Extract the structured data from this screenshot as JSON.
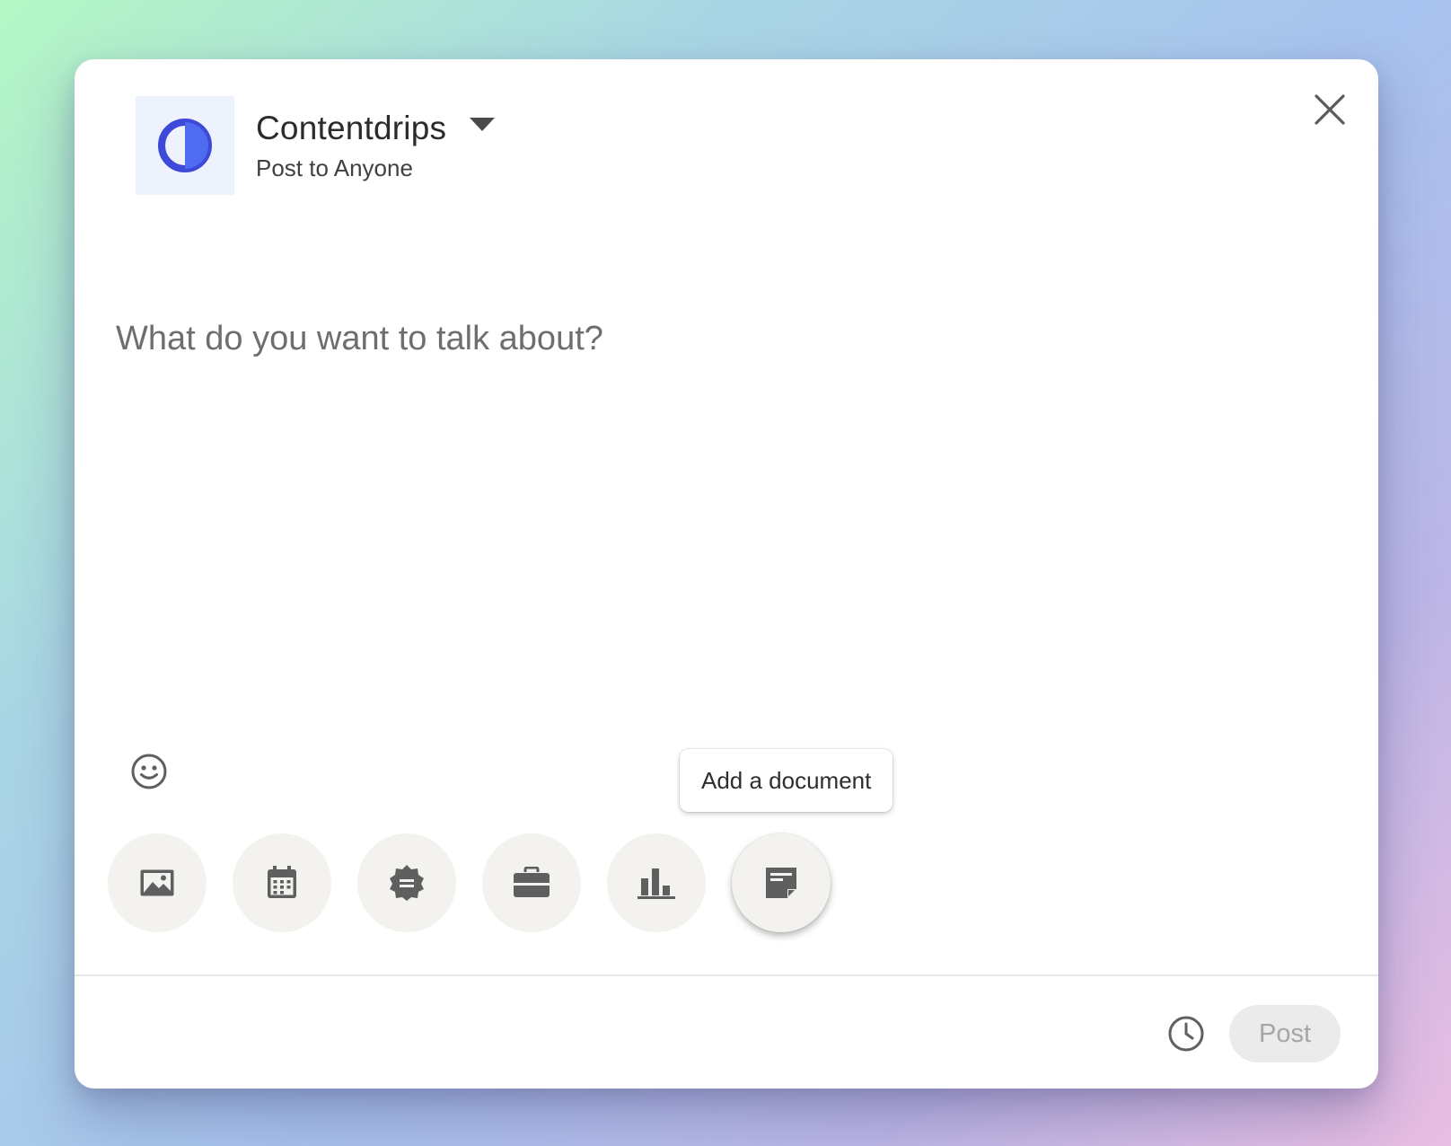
{
  "account": {
    "name": "Contentdrips",
    "audience": "Post to Anyone",
    "avatar_icon": "half-circle-logo-icon",
    "logo_color": "#4b57e6"
  },
  "composer": {
    "placeholder": "What do you want to talk about?"
  },
  "tooltip": {
    "label": "Add a document"
  },
  "tools": [
    {
      "icon": "image-icon",
      "label": "Add a photo"
    },
    {
      "icon": "calendar-icon",
      "label": "Create an event"
    },
    {
      "icon": "badge-icon",
      "label": "Celebrate an occasion"
    },
    {
      "icon": "briefcase-icon",
      "label": "Share that you're hiring"
    },
    {
      "icon": "bar-chart-icon",
      "label": "Create a poll"
    },
    {
      "icon": "document-icon",
      "label": "Add a document"
    }
  ],
  "footer": {
    "schedule_icon": "clock-icon",
    "post_label": "Post"
  },
  "colors": {
    "icon_gray": "#5f5f5f",
    "tool_bg": "#f3f2ef",
    "post_disabled_bg": "#ebebeb",
    "post_disabled_text": "#a6a6a6"
  }
}
